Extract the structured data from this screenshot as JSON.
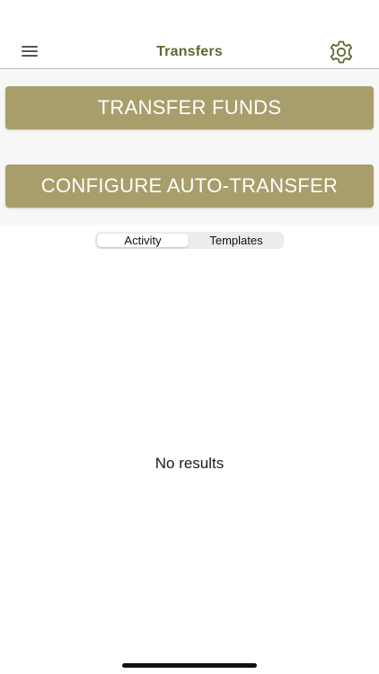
{
  "header": {
    "title": "Transfers",
    "menu_icon": "hamburger-menu-icon",
    "settings_icon": "gear-icon"
  },
  "actions": {
    "transfer_funds_label": "TRANSFER FUNDS",
    "configure_auto_transfer_label": "CONFIGURE AUTO-TRANSFER"
  },
  "tabs": [
    {
      "label": "Activity",
      "selected": true
    },
    {
      "label": "Templates",
      "selected": false
    }
  ],
  "content": {
    "empty_message": "No results"
  },
  "colors": {
    "accent": "#a89e6c",
    "title": "#5d6a2e"
  }
}
